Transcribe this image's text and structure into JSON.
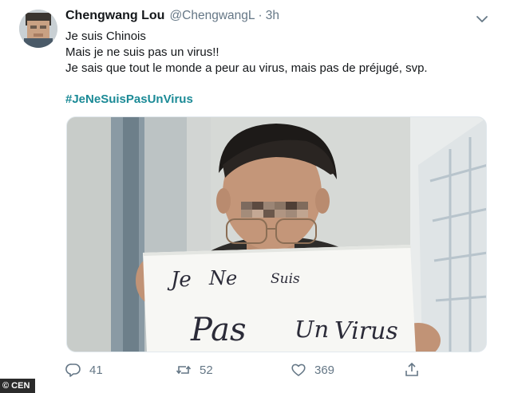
{
  "tweet": {
    "display_name": "Chengwang Lou",
    "handle": "@ChengwangL",
    "separator": "·",
    "timestamp": "3h",
    "lines": [
      "Je suis Chinois",
      "Mais je ne suis pas un virus!!",
      "Je sais que tout le monde a peur au virus, mais pas de préjugé, svp."
    ],
    "hashtag": "#JeNeSuisPasUnVirus",
    "sign_text": {
      "line1": [
        "Je",
        "Ne",
        "Suis"
      ],
      "line2": [
        "Pas",
        "Un",
        "Virus"
      ]
    }
  },
  "actions": {
    "reply_count": "41",
    "retweet_count": "52",
    "like_count": "369"
  },
  "credit": "© CEN",
  "colors": {
    "hashtag": "#1b8a96",
    "muted": "#657786",
    "text": "#14171a"
  },
  "icons": [
    "chevron-down-icon",
    "reply-icon",
    "retweet-icon",
    "like-icon",
    "share-icon"
  ]
}
